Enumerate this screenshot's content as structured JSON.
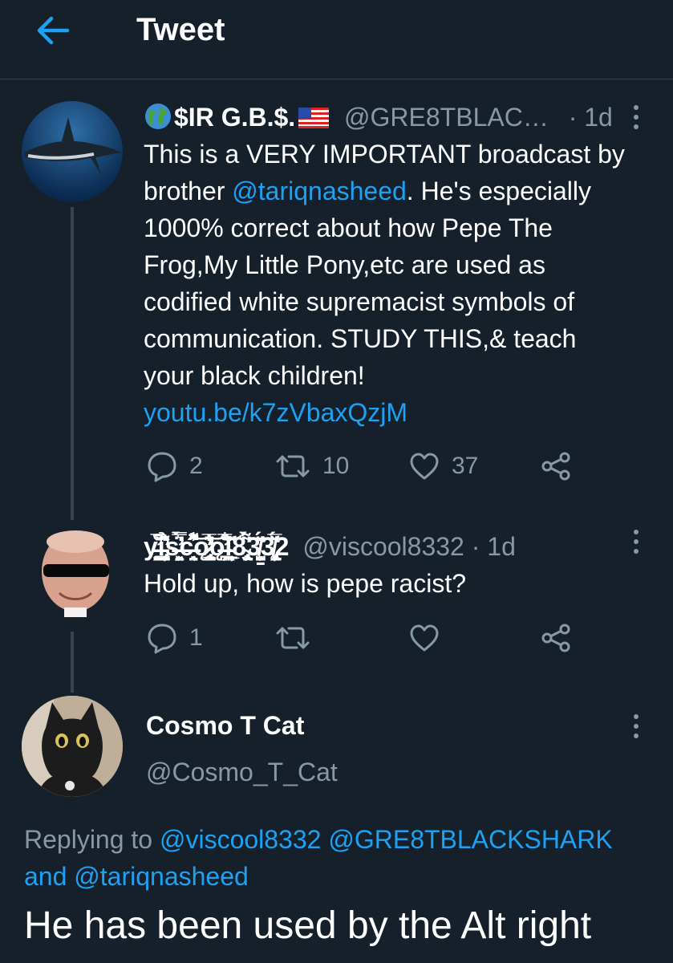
{
  "header": {
    "title": "Tweet"
  },
  "tweet1": {
    "name": "$IR G.B.$.",
    "handle": "@GRE8TBLAC…",
    "time": "· 1d",
    "text_lines": [
      "This is a VERY IMPORTANT broadcast by",
      "brother ",
      "@tariqnasheed",
      ". He's especially",
      "1000% correct about how Pepe The",
      "Frog,My Little Pony,etc are used as",
      "codified white supremacist symbols of",
      "communication. STUDY THIS,& teach",
      "your black children!"
    ],
    "link": "youtu.be/k7zVbaxQzjM",
    "replies": "2",
    "retweets": "10",
    "likes": "37"
  },
  "tweet2": {
    "name": "ỵ̵̛̮̥͚̭̻̮͎̙͐̐̅̆̚i̵̡͖͕͖̪̝̘̦̭̮̾̑̆͐̉̌̂̕s̶̛͖̼̝̹̯̹̿̈́͛̿̀̕c̶̜͉̟̤͌͋̋̾̂̚͝ǫ̷̢̨̛̻̻̰̩͇̊̈̅̍͂̓̕͝͝ǫ̶̛̪̝̪̗̗̹̐̅͋͝l̴̦͎̙̲̩̖̠̆͐̎8̴̢̧̹̮̩̥̈́̀͌3̸̖̳̹̞̺̫͕̈́̓3̸̧̢̭̦̥͚̘̈̆́̅̌2",
    "handle": "@viscool8332",
    "time": "· 1d",
    "text": "Hold up, how is pepe racist?",
    "replies": "1"
  },
  "tweet3": {
    "name": "Cosmo T Cat",
    "handle": "@Cosmo_T_Cat",
    "replying_prefix": "Replying to ",
    "reply_to_1": "@viscool8332",
    "reply_to_2": "@GRE8TBLACKSHARK",
    "reply_and": "and ",
    "reply_to_3": "@tariqnasheed",
    "text": "He has been used by the Alt right"
  },
  "colors": {
    "background": "#15202b",
    "accent": "#1da1f2",
    "muted": "#8899a6",
    "divider": "#38444d"
  },
  "icons": [
    "back-arrow-icon",
    "more-icon",
    "reply-icon",
    "retweet-icon",
    "like-icon",
    "share-icon",
    "globe-icon",
    "us-flag-icon"
  ]
}
